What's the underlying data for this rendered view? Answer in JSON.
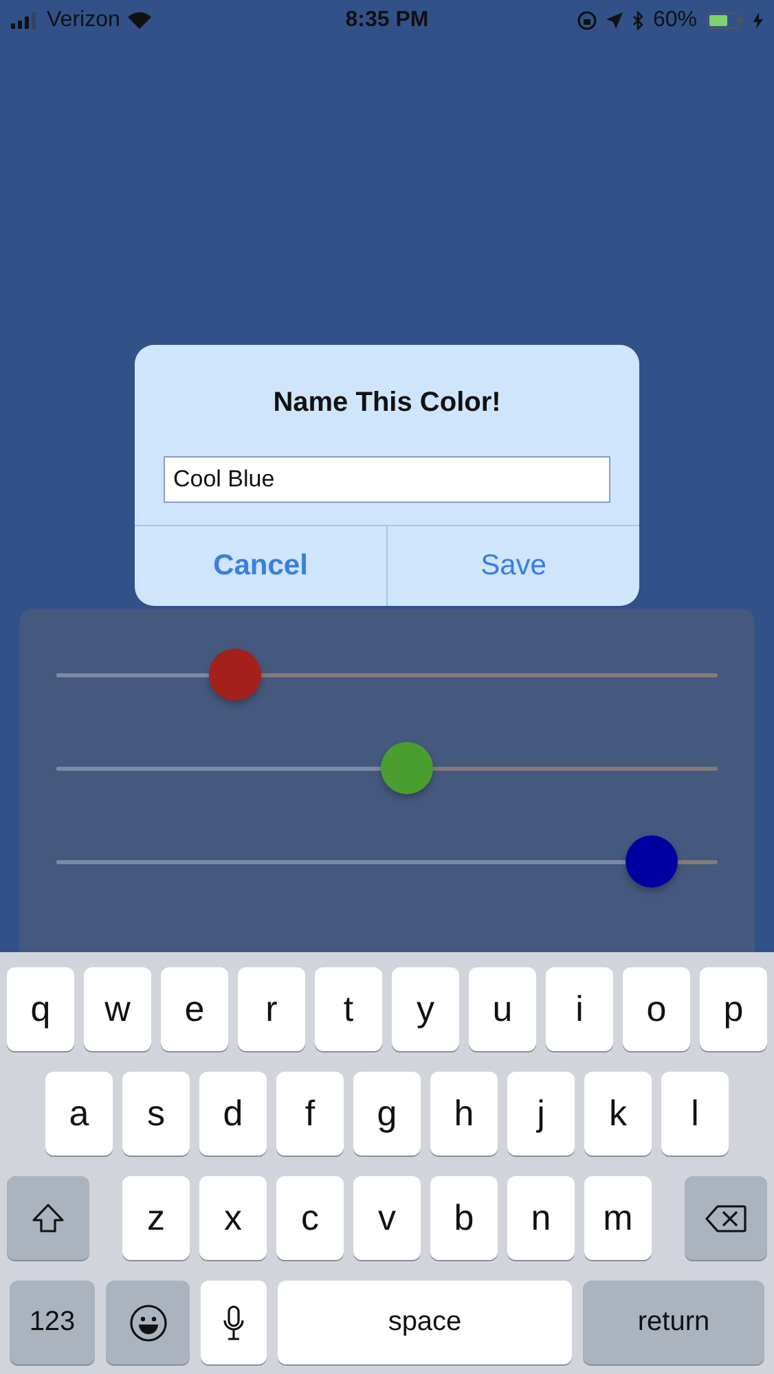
{
  "status_bar": {
    "carrier": "Verizon",
    "time": "8:35 PM",
    "battery": "60%"
  },
  "dialog": {
    "title": "Name This Color!",
    "field": {
      "value": "Cool Blue"
    },
    "buttons": [
      {
        "label": "Cancel",
        "kind": "cancel"
      },
      {
        "label": "Save",
        "kind": "default"
      }
    ]
  },
  "sliders": [
    {
      "color": "#a3201b",
      "level": 0.27
    },
    {
      "color": "#4a9e2f",
      "level": 0.53
    },
    {
      "color": "#0000a0",
      "level": 0.9
    }
  ],
  "keyboard": {
    "rows": [
      {
        "keys": [
          {
            "kind": "letter",
            "label": "q"
          },
          {
            "kind": "letter",
            "label": "w"
          },
          {
            "kind": "letter",
            "label": "e"
          },
          {
            "kind": "letter",
            "label": "r"
          },
          {
            "kind": "letter",
            "label": "t"
          },
          {
            "kind": "letter",
            "label": "y"
          },
          {
            "kind": "letter",
            "label": "u"
          },
          {
            "kind": "letter",
            "label": "i"
          },
          {
            "kind": "letter",
            "label": "o"
          },
          {
            "kind": "letter",
            "label": "p"
          }
        ]
      },
      {
        "keys": [
          {
            "kind": "letter",
            "label": "a"
          },
          {
            "kind": "letter",
            "label": "s"
          },
          {
            "kind": "letter",
            "label": "d"
          },
          {
            "kind": "letter",
            "label": "f"
          },
          {
            "kind": "letter",
            "label": "g"
          },
          {
            "kind": "letter",
            "label": "h"
          },
          {
            "kind": "letter",
            "label": "j"
          },
          {
            "kind": "letter",
            "label": "k"
          },
          {
            "kind": "letter",
            "label": "l"
          }
        ]
      },
      {
        "keys": [
          {
            "kind": "shift"
          },
          {
            "kind": "letter",
            "label": "z"
          },
          {
            "kind": "letter",
            "label": "x"
          },
          {
            "kind": "letter",
            "label": "c"
          },
          {
            "kind": "letter",
            "label": "v"
          },
          {
            "kind": "letter",
            "label": "b"
          },
          {
            "kind": "letter",
            "label": "n"
          },
          {
            "kind": "letter",
            "label": "m"
          },
          {
            "kind": "delete"
          }
        ]
      },
      {
        "keys": [
          {
            "kind": "numbers",
            "label": "123"
          },
          {
            "kind": "emoji"
          },
          {
            "kind": "mic"
          },
          {
            "kind": "space",
            "label": "space"
          },
          {
            "kind": "return",
            "label": "return"
          }
        ]
      }
    ]
  }
}
